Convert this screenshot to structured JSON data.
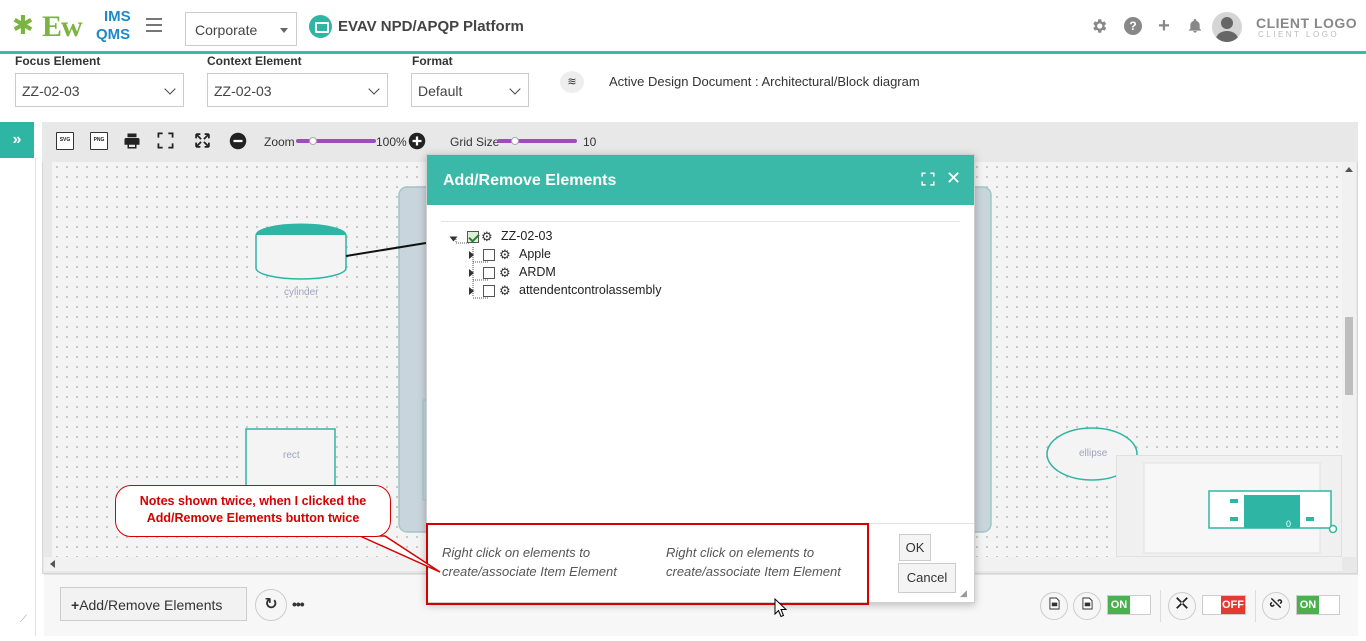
{
  "header": {
    "logo_main": "Ew",
    "logo_top": "IMS",
    "logo_bottom": "QMS",
    "org_select": "Corporate",
    "platform_title": "EVAV NPD/APQP Platform",
    "client_logo": "CLIENT LOGO",
    "client_logo_sub": "CLIENT LOGO",
    "icons": [
      "gear-icon",
      "help-icon",
      "plus-icon",
      "bell-icon",
      "avatar"
    ]
  },
  "filters": {
    "focus_label": "Focus Element",
    "focus_value": "ZZ-02-03",
    "context_label": "Context Element",
    "context_value": "ZZ-02-03",
    "format_label": "Format",
    "format_value": "Default",
    "active_document": "Active Design Document : Architectural/Block diagram"
  },
  "toolbar": {
    "zoom_label": "Zoom",
    "zoom_value": "100%",
    "grid_label": "Grid Size",
    "grid_value": "10",
    "icons": [
      "svg-export-icon",
      "png-export-icon",
      "print-icon",
      "fit-icon",
      "expand-icon",
      "zoom-out-icon",
      "zoom-in-icon"
    ]
  },
  "canvas": {
    "shapes": [
      {
        "kind": "cylinder",
        "label": "cylinder"
      },
      {
        "kind": "rect",
        "label": "rect"
      },
      {
        "kind": "ellipse",
        "label": "ellipse"
      }
    ],
    "minimap_value": "0"
  },
  "modal": {
    "title": "Add/Remove Elements",
    "tree": [
      {
        "label": "ZZ-02-03",
        "checked": true
      },
      {
        "label": "Apple",
        "checked": false
      },
      {
        "label": "ARDM",
        "checked": false
      },
      {
        "label": "attendentcontrolassembly",
        "checked": false
      }
    ],
    "notes": [
      "Right click on elements to create/associate Item Element",
      "Right click on elements to create/associate Item Element"
    ],
    "ok_label": "OK",
    "cancel_label": "Cancel"
  },
  "annotation": {
    "callout_text": "Notes shown twice, when I clicked the Add/Remove Elements button twice"
  },
  "footer": {
    "add_remove_label": "Add/Remove Elements",
    "toggles": [
      {
        "name": "toggle-1",
        "state": "ON"
      },
      {
        "name": "toggle-2",
        "state": "OFF"
      },
      {
        "name": "toggle-3",
        "state": "ON"
      }
    ]
  },
  "colors": {
    "accent": "#3bb9a8",
    "callout_red": "#d50000",
    "slider": "#9c4fb6",
    "on_green": "#4caf50",
    "off_red": "#e53935"
  }
}
